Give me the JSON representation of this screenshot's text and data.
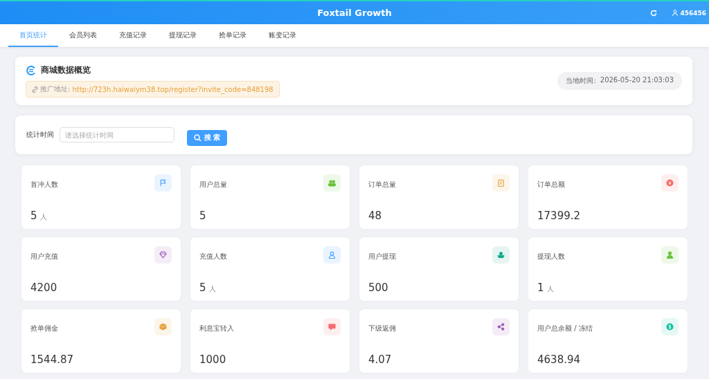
{
  "header": {
    "title": "Foxtail Growth",
    "user": "456456"
  },
  "tabs": [
    {
      "label": "首页统计",
      "selected": true
    },
    {
      "label": "会员列表",
      "selected": false
    },
    {
      "label": "充值记录",
      "selected": false
    },
    {
      "label": "提现记录",
      "selected": false
    },
    {
      "label": "抢单记录",
      "selected": false
    },
    {
      "label": "账变记录",
      "selected": false
    }
  ],
  "overview": {
    "title": "商城数据概览",
    "link_label": "推广地址:",
    "link": "http://723h.haiwaiym38.top/register?invite_code=848198",
    "time_label": "当地时间:",
    "time": "2026-05-20 21:03:03"
  },
  "filter": {
    "label": "统计时间",
    "placeholder": "请选择统计时间",
    "button": "搜 索"
  },
  "stats": [
    {
      "label": "首冲人数",
      "value": "5",
      "unit": "人",
      "kind": "flag",
      "color": "#409eff"
    },
    {
      "label": "用户总量",
      "value": "5",
      "kind": "users",
      "color": "#67c23a"
    },
    {
      "label": "订单总量",
      "value": "48",
      "kind": "clipboard",
      "color": "#e6a23c"
    },
    {
      "label": "订单总额",
      "value": "17399.2",
      "kind": "yen",
      "color": "#f56c6c"
    },
    {
      "label": "用户充值",
      "value": "4200",
      "kind": "diamond",
      "color": "#9b59b6"
    },
    {
      "label": "充值人数",
      "value": "5",
      "unit": "人",
      "kind": "user-outline",
      "color": "#409eff"
    },
    {
      "label": "用户提现",
      "value": "500",
      "kind": "boat",
      "color": "#13a88a"
    },
    {
      "label": "提现人数",
      "value": "1",
      "unit": "人",
      "kind": "person",
      "color": "#67c23a"
    },
    {
      "label": "抢单佣金",
      "value": "1544.87",
      "kind": "box",
      "color": "#e6a23c"
    },
    {
      "label": "利息宝转入",
      "value": "1000",
      "kind": "message",
      "color": "#f56c6c"
    },
    {
      "label": "下级返佣",
      "value": "4.07",
      "kind": "share",
      "color": "#9b59b6"
    },
    {
      "label": "用户总余额 / 冻结",
      "value": "4638.94",
      "kind": "dollar",
      "color": "#13c2a2"
    }
  ]
}
